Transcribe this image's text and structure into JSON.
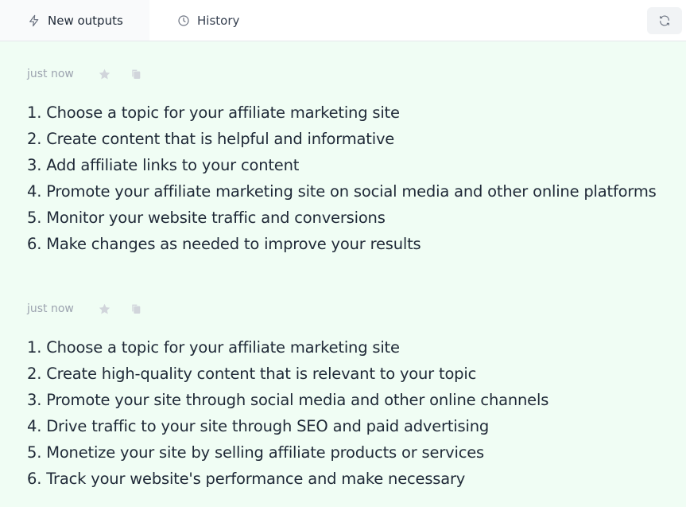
{
  "tabs": [
    {
      "label": "New outputs",
      "icon": "lightning-icon",
      "active": true
    },
    {
      "label": "History",
      "icon": "clock-icon",
      "active": false
    }
  ],
  "toolbar": {
    "refresh_icon": "refresh-icon"
  },
  "colors": {
    "background": "#f0fdf4",
    "text": "#1f2937",
    "muted": "#9ca3af",
    "icon_muted": "#d1d5db"
  },
  "results": [
    {
      "timestamp": "just now",
      "lines": [
        "1. Choose a topic for your affiliate marketing site",
        "2. Create content that is helpful and informative",
        "3. Add affiliate links to your content",
        "4. Promote your affiliate marketing site on social media and other online platforms",
        "5. Monitor your website traffic and conversions",
        "6. Make changes as needed to improve your results"
      ]
    },
    {
      "timestamp": "just now",
      "lines": [
        "1. Choose a topic for your affiliate marketing site",
        "2. Create high-quality content that is relevant to your topic",
        "3. Promote your site through social media and other online channels",
        "4. Drive traffic to your site through SEO and paid advertising",
        "5. Monetize your site by selling affiliate products or services",
        "6. Track your website's performance and make necessary"
      ]
    }
  ]
}
